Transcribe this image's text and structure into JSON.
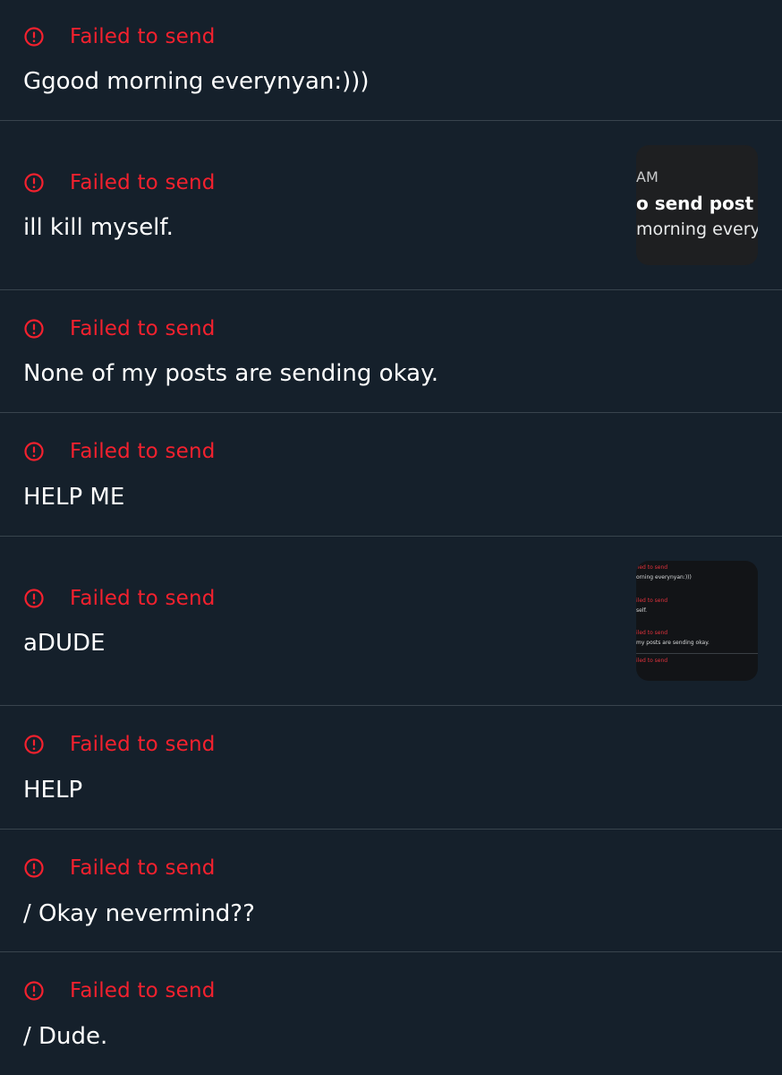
{
  "status_label": "Failed to send",
  "posts": [
    {
      "text": "Ggood morning everynyan:)))"
    },
    {
      "text": "ill kill myself."
    },
    {
      "text": "None of my posts are sending okay."
    },
    {
      "text": "HELP ME"
    },
    {
      "text": "aDUDE"
    },
    {
      "text": "HELP"
    },
    {
      "text": "/ Okay nevermind??"
    },
    {
      "text": "/ Dude."
    }
  ],
  "thumb1": {
    "line1": "AM",
    "line2": "o send post",
    "line3": "morning everyny"
  },
  "thumb2": {
    "lines": [
      "iled to send",
      "orning everynyan:)))",
      "iled to send",
      "self.",
      "iled to send",
      "my posts are sending okay.",
      "iled to send"
    ]
  },
  "colors": {
    "background": "#15202b",
    "error_red": "#f4212e",
    "divider": "#38444d",
    "text": "#ffffff"
  },
  "icons": {
    "status": "error-circle-icon"
  }
}
